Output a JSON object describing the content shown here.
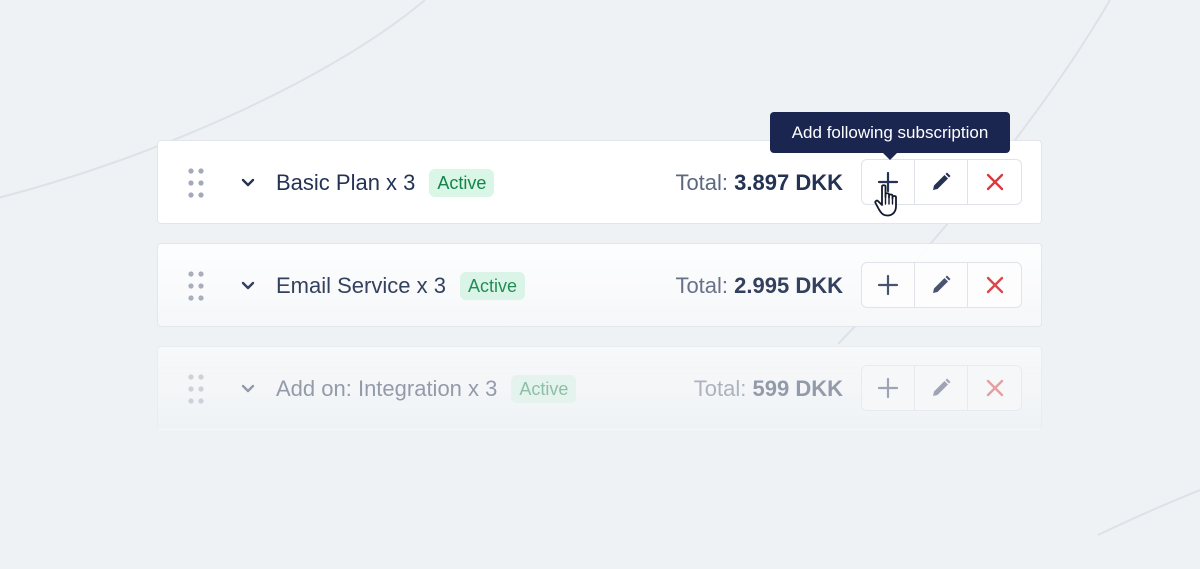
{
  "tooltip": {
    "text": "Add following subscription"
  },
  "rows": [
    {
      "name": "Basic Plan x 3",
      "status": "Active",
      "total_label": "Total:",
      "total_amount": "3.897 DKK"
    },
    {
      "name": "Email Service x 3",
      "status": "Active",
      "total_label": "Total:",
      "total_amount": "2.995 DKK"
    },
    {
      "name": "Add on: Integration x 3",
      "status": "Active",
      "total_label": "Total:",
      "total_amount": "599 DKK"
    }
  ],
  "icons": {
    "drag": "drag-handle-icon",
    "expand": "chevron-down-icon",
    "add": "plus-icon",
    "edit": "pencil-icon",
    "delete": "close-icon",
    "cursor": "hand-pointer-icon"
  },
  "colors": {
    "background": "#eff2f5",
    "text_primary": "#243253",
    "text_muted": "#5d6780",
    "badge_bg": "#d9f6e6",
    "badge_text": "#13854a",
    "tooltip_bg": "#1a2550",
    "delete": "#d9393e",
    "icon_dark": "#3d4766"
  }
}
